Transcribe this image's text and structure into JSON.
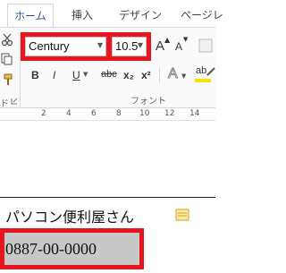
{
  "ribbon": {
    "tabs": [
      {
        "label": "ホーム",
        "active": true
      },
      {
        "label": "挿入"
      },
      {
        "label": "デザイン"
      },
      {
        "label": "ページレ"
      }
    ],
    "font_name": "Century",
    "font_size": "10.5",
    "format_buttons": {
      "bold": "B",
      "italic": "I",
      "underline": "U",
      "strikethrough": "abc",
      "subscript": "x₂",
      "superscript": "x²",
      "grow": "A",
      "shrink": "A",
      "text_effects": "A",
      "highlight": "ab"
    },
    "group_label_font": "フォント",
    "group_label_clipboard": "ド"
  },
  "ruler": {
    "ticks": [
      "2",
      "4",
      "6",
      "8",
      "10",
      "12",
      "14"
    ]
  },
  "document": {
    "line1": "パソコン便利屋さん",
    "phone": "0887-00-0000"
  },
  "colors": {
    "highlight_red": "#e8141f",
    "selection_gray": "#c8c8c8",
    "accent": "#2b579a"
  }
}
